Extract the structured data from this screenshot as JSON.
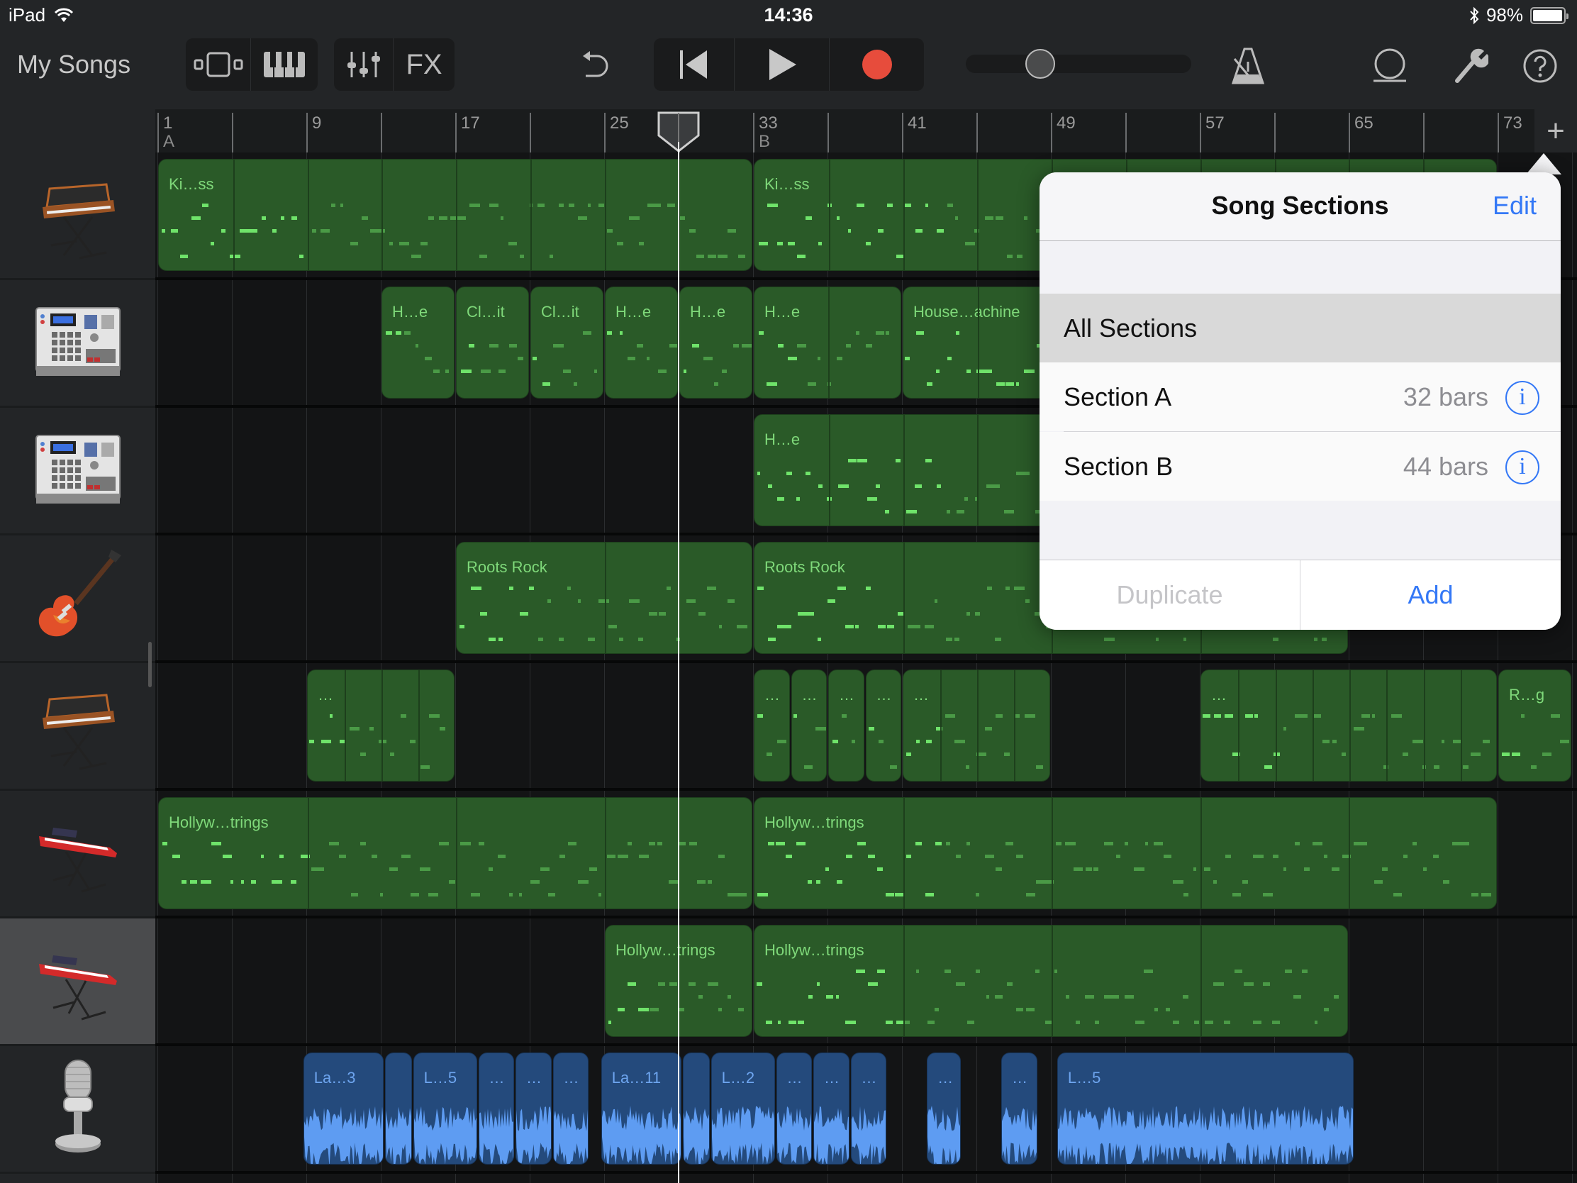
{
  "status_bar": {
    "device": "iPad",
    "time": "14:36",
    "battery": "98%",
    "battery_level": 0.98,
    "icons": [
      "wifi-icon",
      "bluetooth-icon",
      "battery-icon"
    ]
  },
  "toolbar": {
    "my_songs": "My Songs",
    "view_buttons": [
      {
        "name": "tracks-view",
        "icon": "tracks-view-icon"
      },
      {
        "name": "keyboard",
        "icon": "piano-keys-icon"
      }
    ],
    "mixer_buttons": [
      {
        "name": "mixer",
        "icon": "sliders-icon"
      },
      {
        "name": "fx",
        "label": "FX"
      }
    ],
    "undo_icon": "undo-icon",
    "transport": [
      {
        "name": "go-to-start",
        "icon": "skip-back-icon"
      },
      {
        "name": "play",
        "icon": "play-icon"
      },
      {
        "name": "record",
        "icon": "record-icon"
      }
    ],
    "master_volume": 0.33,
    "right_icons": [
      "metronome-icon",
      "loop-browser-icon",
      "settings-wrench-icon",
      "help-icon"
    ],
    "colors": {
      "record": "#e74c3c",
      "icon": "#bdbdbd"
    }
  },
  "ruler": {
    "bar_labels": [
      "1",
      "9",
      "17",
      "25",
      "33",
      "41",
      "49",
      "57",
      "65",
      "73"
    ],
    "section_markers": [
      {
        "bar": 1,
        "label": "A"
      },
      {
        "bar": 33,
        "label": "B"
      }
    ],
    "playhead_bar": 29.0,
    "add_track_label": "+"
  },
  "tracks": [
    {
      "instrument": "analog-synth",
      "icon": "analog-synth-icon",
      "selected": false,
      "regions": [
        {
          "start": 1,
          "end": 33,
          "label": "Ki…ss",
          "type": "midi",
          "loops": 8
        },
        {
          "start": 33,
          "end": 73,
          "label": "Ki…ss",
          "type": "midi",
          "loops": 10
        }
      ]
    },
    {
      "instrument": "drum-machine",
      "icon": "drum-machine-icon",
      "selected": false,
      "regions": [
        {
          "start": 13,
          "end": 17,
          "label": "H…e",
          "type": "midi"
        },
        {
          "start": 17,
          "end": 21,
          "label": "Cl…it",
          "type": "midi"
        },
        {
          "start": 21,
          "end": 25,
          "label": "Cl…it",
          "type": "midi"
        },
        {
          "start": 25,
          "end": 29,
          "label": "H…e",
          "type": "midi"
        },
        {
          "start": 29,
          "end": 33,
          "label": "H…e",
          "type": "midi"
        },
        {
          "start": 33,
          "end": 41,
          "label": "H…e",
          "type": "midi",
          "loops": 2
        },
        {
          "start": 41,
          "end": 73,
          "label": "House…achine",
          "type": "midi",
          "loops": 8
        }
      ]
    },
    {
      "instrument": "drum-machine",
      "icon": "drum-machine-icon",
      "selected": false,
      "regions": [
        {
          "start": 33,
          "end": 73,
          "label": "H…e",
          "type": "midi",
          "loops": 10
        }
      ]
    },
    {
      "instrument": "electric-guitar",
      "icon": "electric-guitar-icon",
      "selected": false,
      "regions": [
        {
          "start": 17,
          "end": 33,
          "label": "Roots Rock",
          "type": "midi",
          "loops": 2
        },
        {
          "start": 33,
          "end": 65,
          "label": "Roots Rock",
          "type": "midi",
          "loops": 4
        }
      ]
    },
    {
      "instrument": "analog-synth",
      "icon": "analog-synth-icon",
      "selected": false,
      "regions": [
        {
          "start": 9,
          "end": 17,
          "label": "…",
          "type": "midi",
          "loops": 4
        },
        {
          "start": 33,
          "end": 35,
          "label": "…",
          "type": "midi"
        },
        {
          "start": 35,
          "end": 37,
          "label": "…",
          "type": "midi"
        },
        {
          "start": 37,
          "end": 39,
          "label": "…",
          "type": "midi"
        },
        {
          "start": 39,
          "end": 41,
          "label": "…",
          "type": "midi"
        },
        {
          "start": 41,
          "end": 49,
          "label": "…",
          "type": "midi",
          "loops": 4
        },
        {
          "start": 57,
          "end": 73,
          "label": "…",
          "type": "midi",
          "loops": 8
        },
        {
          "start": 73,
          "end": 77,
          "label": "R…g",
          "type": "midi"
        }
      ]
    },
    {
      "instrument": "stage-keyboard",
      "icon": "stage-keyboard-icon",
      "selected": false,
      "regions": [
        {
          "start": 1,
          "end": 33,
          "label": "Hollyw…trings",
          "type": "midi",
          "loops": 4
        },
        {
          "start": 33,
          "end": 73,
          "label": "Hollyw…trings",
          "type": "midi",
          "loops": 5
        }
      ]
    },
    {
      "instrument": "stage-keyboard",
      "icon": "stage-keyboard-icon",
      "selected": true,
      "regions": [
        {
          "start": 25,
          "end": 33,
          "label": "Hollyw…trings",
          "type": "midi"
        },
        {
          "start": 33,
          "end": 65,
          "label": "Hollyw…trings",
          "type": "midi",
          "loops": 4
        }
      ]
    },
    {
      "instrument": "microphone",
      "icon": "microphone-icon",
      "selected": false,
      "regions": [
        {
          "start": 8.8,
          "end": 13.2,
          "label": "La…3",
          "type": "audio"
        },
        {
          "start": 13.2,
          "end": 14.7,
          "label": "",
          "type": "audio"
        },
        {
          "start": 14.7,
          "end": 18.2,
          "label": "L…5",
          "type": "audio"
        },
        {
          "start": 18.2,
          "end": 20.2,
          "label": "…",
          "type": "audio"
        },
        {
          "start": 20.2,
          "end": 22.2,
          "label": "…",
          "type": "audio"
        },
        {
          "start": 22.2,
          "end": 24.2,
          "label": "…",
          "type": "audio"
        },
        {
          "start": 24.8,
          "end": 29.2,
          "label": "La…11",
          "type": "audio"
        },
        {
          "start": 29.2,
          "end": 30.7,
          "label": "",
          "type": "audio"
        },
        {
          "start": 30.7,
          "end": 34.2,
          "label": "L…2",
          "type": "audio"
        },
        {
          "start": 34.2,
          "end": 36.2,
          "label": "…",
          "type": "audio"
        },
        {
          "start": 36.2,
          "end": 38.2,
          "label": "…",
          "type": "audio"
        },
        {
          "start": 38.2,
          "end": 40.2,
          "label": "…",
          "type": "audio"
        },
        {
          "start": 42.3,
          "end": 44.2,
          "label": "…",
          "type": "audio"
        },
        {
          "start": 46.3,
          "end": 48.3,
          "label": "…",
          "type": "audio"
        },
        {
          "start": 49.3,
          "end": 65.3,
          "label": "L…5",
          "type": "audio",
          "loops": 4
        }
      ]
    }
  ],
  "popover": {
    "title": "Song Sections",
    "edit": "Edit",
    "rows": [
      {
        "name": "All Sections",
        "bars": "",
        "selected": true,
        "info": false
      },
      {
        "name": "Section A",
        "bars": "32 bars",
        "selected": false,
        "info": true
      },
      {
        "name": "Section B",
        "bars": "44 bars",
        "selected": false,
        "info": true
      }
    ],
    "duplicate": "Duplicate",
    "add": "Add",
    "accent": "#3478f6"
  }
}
